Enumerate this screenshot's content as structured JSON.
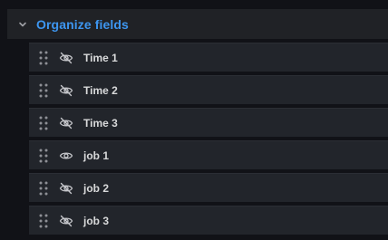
{
  "section": {
    "title": "Organize fields",
    "expanded": true
  },
  "fields": [
    {
      "label": "Time 1",
      "visible": false
    },
    {
      "label": "Time 2",
      "visible": false
    },
    {
      "label": "Time 3",
      "visible": false
    },
    {
      "label": "job 1",
      "visible": true
    },
    {
      "label": "job 2",
      "visible": false
    },
    {
      "label": "job 3",
      "visible": false
    }
  ],
  "colors": {
    "accent": "#3d96f0",
    "row_background": "#22252b",
    "icon": "#c7c8cc",
    "text": "#d8d9da"
  }
}
